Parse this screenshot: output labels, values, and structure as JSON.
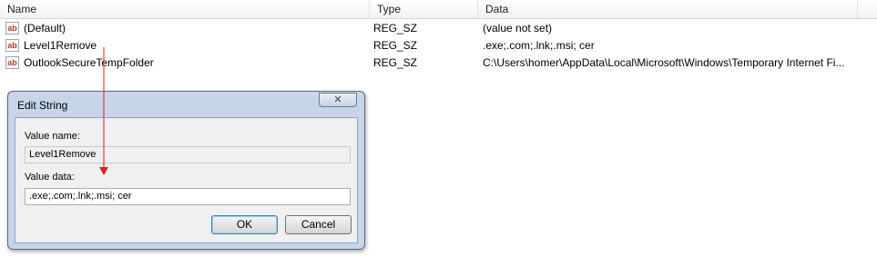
{
  "columns": {
    "name": "Name",
    "type": "Type",
    "data": "Data"
  },
  "rows": [
    {
      "icon": "ab",
      "name": "(Default)",
      "type": "REG_SZ",
      "data": "(value not set)"
    },
    {
      "icon": "ab",
      "name": "Level1Remove",
      "type": "REG_SZ",
      "data": ".exe;.com;.lnk;.msi; cer"
    },
    {
      "icon": "ab",
      "name": "OutlookSecureTempFolder",
      "type": "REG_SZ",
      "data": "C:\\Users\\homer\\AppData\\Local\\Microsoft\\Windows\\Temporary Internet Fi..."
    }
  ],
  "dialog": {
    "title": "Edit String",
    "close_label": "✕",
    "value_name_label": "Value name:",
    "value_name": "Level1Remove",
    "value_data_label": "Value data:",
    "value_data": ".exe;.com;.lnk;.msi; cer",
    "ok_label": "OK",
    "cancel_label": "Cancel"
  },
  "colors": {
    "arrow": "#e02020",
    "dialog_frame": "#c6d5e8"
  },
  "icons": {
    "registry_value": "string-value-icon"
  }
}
